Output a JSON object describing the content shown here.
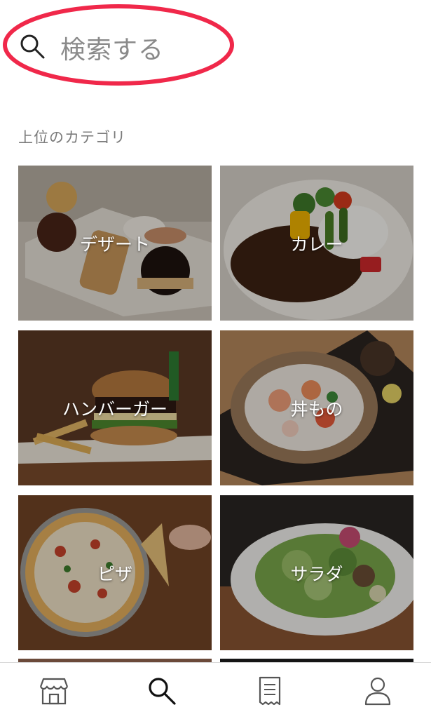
{
  "search": {
    "placeholder": "検索する"
  },
  "categories_section": {
    "title": "上位のカテゴリ",
    "items": [
      {
        "label": "デザート"
      },
      {
        "label": "カレー"
      },
      {
        "label": "ハンバーガー"
      },
      {
        "label": "丼もの"
      },
      {
        "label": "ピザ"
      },
      {
        "label": "サラダ"
      }
    ]
  },
  "annotation": {
    "highlight_color": "#f0284a"
  },
  "tabbar": {
    "items": [
      {
        "icon": "store-icon"
      },
      {
        "icon": "search-icon",
        "active": true
      },
      {
        "icon": "receipt-icon"
      },
      {
        "icon": "account-icon"
      }
    ]
  }
}
